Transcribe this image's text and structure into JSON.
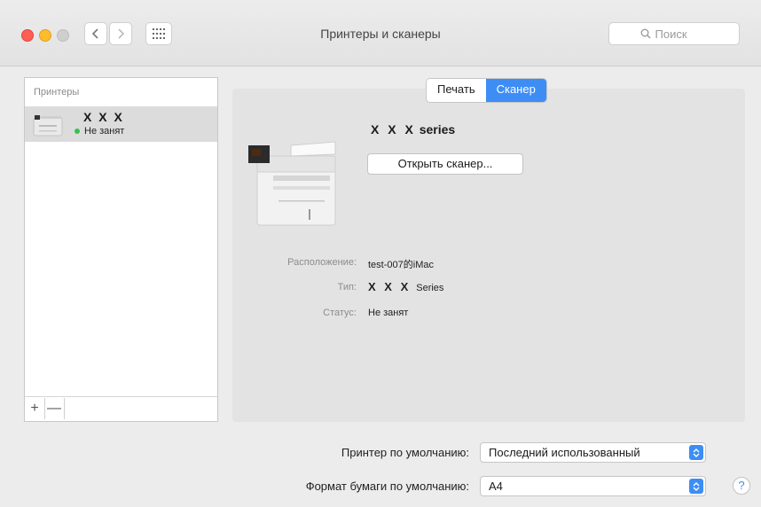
{
  "window": {
    "title": "Принтеры и сканеры",
    "search_placeholder": "Поиск"
  },
  "sidebar": {
    "header": "Принтеры",
    "items": [
      {
        "name": "X X X",
        "status": "Не занят"
      }
    ],
    "add_label": "+",
    "remove_label": "—"
  },
  "tabs": [
    {
      "label": "Печать",
      "selected": false
    },
    {
      "label": "Сканер",
      "selected": true
    }
  ],
  "device": {
    "name_prefix": "X X X",
    "name_suffix": "series",
    "open_button": "Открыть сканер..."
  },
  "info": {
    "location_label": "Расположение:",
    "location_value": "test-007的iMac",
    "type_label": "Тип:",
    "type_prefix": "X X X",
    "type_suffix": "Series",
    "status_label": "Статус:",
    "status_value": "Не занят"
  },
  "defaults": {
    "printer_label": "Принтер по умолчанию:",
    "printer_value": "Последний использованный",
    "paper_label": "Формат бумаги по умолчанию:",
    "paper_value": "A4"
  },
  "help_label": "?",
  "colors": {
    "accent": "#3d8df5",
    "status_ok": "#37c152",
    "close": "#fd5f57",
    "minimize": "#febc2e"
  },
  "icons": [
    "back-icon",
    "forward-icon",
    "grid-icon",
    "search-icon",
    "printer-icon",
    "status-dot-icon",
    "stepper-icon",
    "help-icon"
  ]
}
